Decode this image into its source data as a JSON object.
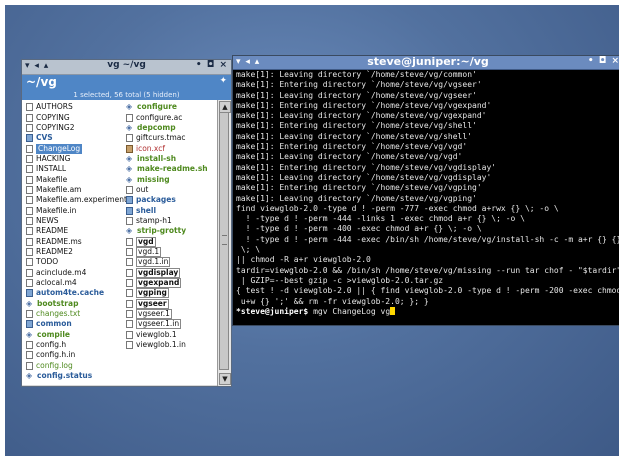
{
  "file_manager": {
    "title_left": "▾ ◂ ▴",
    "title": "vg ~/vg",
    "title_right": "• ◘ ×",
    "path": "~/vg",
    "path_icon": "✦",
    "status": "1 selected, 56 total (5 hidden)",
    "column1": [
      {
        "name": "AUTHORS",
        "type": "doc",
        "style": ""
      },
      {
        "name": "COPYING",
        "type": "doc",
        "style": ""
      },
      {
        "name": "COPYING2",
        "type": "doc",
        "style": ""
      },
      {
        "name": "CVS",
        "type": "dir",
        "style": "t-blue"
      },
      {
        "name": "ChangeLog",
        "type": "doc",
        "style": "sel"
      },
      {
        "name": "HACKING",
        "type": "doc",
        "style": ""
      },
      {
        "name": "INSTALL",
        "type": "doc",
        "style": ""
      },
      {
        "name": "Makefile",
        "type": "doc",
        "style": ""
      },
      {
        "name": "Makefile.am",
        "type": "doc",
        "style": ""
      },
      {
        "name": "Makefile.am.experiment",
        "type": "doc",
        "style": ""
      },
      {
        "name": "Makefile.in",
        "type": "doc",
        "style": ""
      },
      {
        "name": "NEWS",
        "type": "doc",
        "style": ""
      },
      {
        "name": "README",
        "type": "doc",
        "style": ""
      },
      {
        "name": "README.ms",
        "type": "doc",
        "style": ""
      },
      {
        "name": "README2",
        "type": "doc",
        "style": ""
      },
      {
        "name": "TODO",
        "type": "doc",
        "style": ""
      },
      {
        "name": "acinclude.m4",
        "type": "doc",
        "style": ""
      },
      {
        "name": "aclocal.m4",
        "type": "doc",
        "style": ""
      },
      {
        "name": "autom4te.cache",
        "type": "dir",
        "style": "t-blue"
      },
      {
        "name": "bootstrap",
        "type": "exec",
        "style": "t-green"
      },
      {
        "name": "changes.txt",
        "type": "doc",
        "style": "t-green2"
      },
      {
        "name": "common",
        "type": "dir",
        "style": "t-blue"
      },
      {
        "name": "compile",
        "type": "exec",
        "style": "t-green"
      },
      {
        "name": "config.h",
        "type": "doc",
        "style": ""
      },
      {
        "name": "config.h.in",
        "type": "doc",
        "style": ""
      },
      {
        "name": "config.log",
        "type": "doc",
        "style": "t-green2"
      },
      {
        "name": "config.status",
        "type": "exec",
        "style": "t-blue"
      }
    ],
    "column2": [
      {
        "name": "configure",
        "type": "exec",
        "style": "t-green"
      },
      {
        "name": "configure.ac",
        "type": "doc",
        "style": ""
      },
      {
        "name": "depcomp",
        "type": "exec",
        "style": "t-green"
      },
      {
        "name": "giftcurs.tmac",
        "type": "doc",
        "style": ""
      },
      {
        "name": "icon.xcf",
        "type": "img",
        "style": "t-red"
      },
      {
        "name": "install-sh",
        "type": "exec",
        "style": "t-green"
      },
      {
        "name": "make-readme.sh",
        "type": "exec",
        "style": "t-green"
      },
      {
        "name": "missing",
        "type": "exec",
        "style": "t-green"
      },
      {
        "name": "out",
        "type": "doc",
        "style": ""
      },
      {
        "name": "packages",
        "type": "dir",
        "style": "t-blue"
      },
      {
        "name": "shell",
        "type": "dir",
        "style": "t-blue"
      },
      {
        "name": "stamp-h1",
        "type": "doc",
        "style": ""
      },
      {
        "name": "strip-grotty",
        "type": "exec",
        "style": "t-green"
      },
      {
        "name": "vgd",
        "type": "doc",
        "style": "t-bold outlined"
      },
      {
        "name": "vgd.1",
        "type": "doc",
        "style": "outlined"
      },
      {
        "name": "vgd.1.in",
        "type": "doc",
        "style": "outlined"
      },
      {
        "name": "vgdisplay",
        "type": "doc",
        "style": "t-bold outlined"
      },
      {
        "name": "vgexpand",
        "type": "doc",
        "style": "t-bold outlined"
      },
      {
        "name": "vgping",
        "type": "doc",
        "style": "t-bold outlined"
      },
      {
        "name": "vgseer",
        "type": "doc",
        "style": "t-bold outlined"
      },
      {
        "name": "vgseer.1",
        "type": "doc",
        "style": "outlined"
      },
      {
        "name": "vgseer.1.in",
        "type": "doc",
        "style": "outlined"
      },
      {
        "name": "viewglob.1",
        "type": "doc",
        "style": ""
      },
      {
        "name": "viewglob.1.in",
        "type": "doc",
        "style": ""
      }
    ]
  },
  "terminal": {
    "title_left": "▾ ◂ ▴",
    "title": "steve@juniper:~/vg",
    "title_right": "• ◘ ×",
    "lines": [
      "make[1]: Leaving directory `/home/steve/vg/common'",
      "make[1]: Entering directory `/home/steve/vg/vgseer'",
      "make[1]: Leaving directory `/home/steve/vg/vgseer'",
      "make[1]: Entering directory `/home/steve/vg/vgexpand'",
      "make[1]: Leaving directory `/home/steve/vg/vgexpand'",
      "make[1]: Entering directory `/home/steve/vg/shell'",
      "make[1]: Leaving directory `/home/steve/vg/shell'",
      "make[1]: Entering directory `/home/steve/vg/vgd'",
      "make[1]: Leaving directory `/home/steve/vg/vgd'",
      "make[1]: Entering directory `/home/steve/vg/vgdisplay'",
      "make[1]: Leaving directory `/home/steve/vg/vgdisplay'",
      "make[1]: Entering directory `/home/steve/vg/vgping'",
      "make[1]: Leaving directory `/home/steve/vg/vgping'",
      "find viewglob-2.0 -type d ! -perm -777 -exec chmod a+rwx {} \\; -o \\",
      "  ! -type d ! -perm -444 -links 1 -exec chmod a+r {} \\; -o \\",
      "  ! -type d ! -perm -400 -exec chmod a+r {} \\; -o \\",
      "  ! -type d ! -perm -444 -exec /bin/sh /home/steve/vg/install-sh -c -m a+r {} {}",
      " \\; \\",
      "|| chmod -R a+r viewglob-2.0",
      "tardir=viewglob-2.0 && /bin/sh /home/steve/vg/missing --run tar chof - \"$tardir\"",
      " | GZIP=--best gzip -c >viewglob-2.0.tar.gz",
      "{ test ! -d viewglob-2.0 || { find viewglob-2.0 -type d ! -perm -200 -exec chmod",
      " u+w {} ';' && rm -fr viewglob-2.0; }; }"
    ],
    "prompt": "*steve@juniper$",
    "command": " mgv ChangeLog vg"
  }
}
